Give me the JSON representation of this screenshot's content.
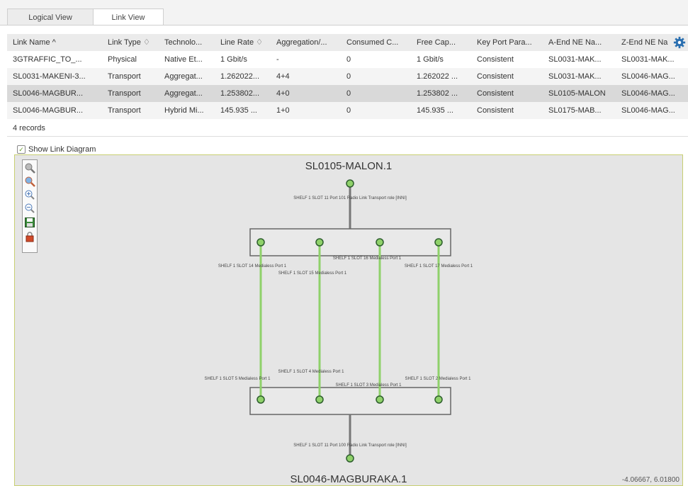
{
  "tabs": [
    {
      "label": "Logical View",
      "active": false
    },
    {
      "label": "Link View",
      "active": true
    }
  ],
  "table": {
    "columns": [
      "Link Name ^",
      "Link Type ♢",
      "Technolo...",
      "Line Rate ♢",
      "Aggregation/...",
      "Consumed C...",
      "Free Cap...",
      "Key Port Para...",
      "A-End NE Na...",
      "Z-End NE Na"
    ],
    "rows": [
      [
        "3GTRAFFIC_TO_...",
        "Physical",
        "Native Et...",
        "1 Gbit/s",
        "-",
        "0",
        "1 Gbit/s",
        "Consistent",
        "SL0031-MAK...",
        "SL0031-MAK..."
      ],
      [
        "SL0031-MAKENI-3...",
        "Transport",
        "Aggregat...",
        "1.262022...",
        "4+4",
        "0",
        "1.262022 ...",
        "Consistent",
        "SL0031-MAK...",
        "SL0046-MAG..."
      ],
      [
        "SL0046-MAGBUR...",
        "Transport",
        "Aggregat...",
        "1.253802...",
        "4+0",
        "0",
        "1.253802 ...",
        "Consistent",
        "SL0105-MALON",
        "SL0046-MAG..."
      ],
      [
        "SL0046-MAGBUR...",
        "Transport",
        "Hybrid Mi...",
        "145.935 ...",
        "1+0",
        "0",
        "145.935 ...",
        "Consistent",
        "SL0175-MAB...",
        "SL0046-MAG..."
      ]
    ],
    "selected_row": 2,
    "record_count": "4 records"
  },
  "show_link_diagram": {
    "label": "Show Link Diagram",
    "checked": true
  },
  "diagram": {
    "top_node": "SL0105-MALON.1",
    "bottom_node": "SL0046-MAGBURAKA.1",
    "top_port_label": "SHELF 1 SLOT 11 Port 101 Radio Link Transport role [INNI]",
    "bottom_port_label": "SHELF 1 SLOT 11 Port 100 Radio Link Transport role [INNI]",
    "upper_ports": [
      "SHELF 1 SLOT 14 Medialess Port 1",
      "SHELF 1 SLOT 15 Medialess Port 1",
      "SHELF 1 SLOT 16 Medialess Port 1",
      "SHELF 1 SLOT 17 Medialess Port 1"
    ],
    "lower_ports": [
      "SHELF 1 SLOT 5 Medialess Port 1",
      "SHELF 1 SLOT 4 Medialess Port 1",
      "SHELF 1 SLOT 3 Medialess Port 1",
      "SHELF 1 SLOT 2 Medialess Port 1"
    ],
    "coordinates": "-4.06667, 6.01800",
    "colors": {
      "link": "#8fd16a",
      "node_fill": "#8fd16a",
      "node_stroke": "#2e5e2e",
      "trunk": "#777777",
      "background": "#e5e5e5"
    },
    "tools": [
      "select-zoom-icon",
      "zoom-fit-icon",
      "zoom-in-icon",
      "zoom-out-icon",
      "save-icon",
      "lock-icon"
    ]
  },
  "colors": {
    "accent_gear": "#2a6fb0",
    "selected_row": "#d9d9d9"
  }
}
